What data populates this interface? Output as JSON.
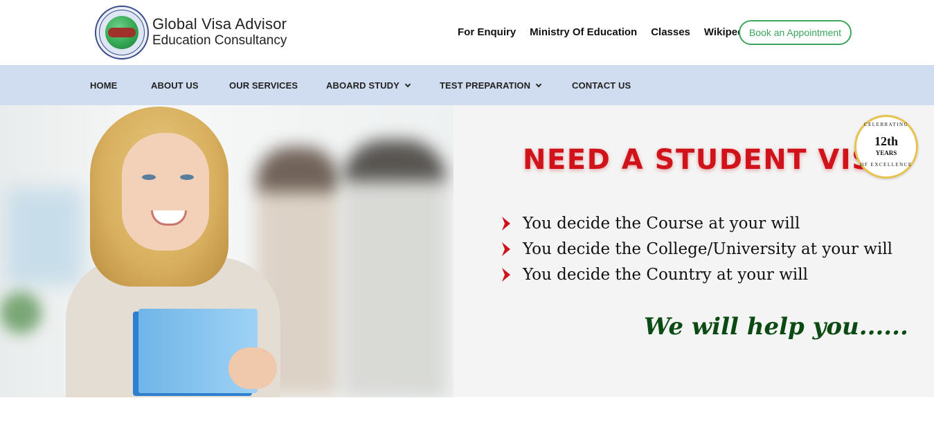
{
  "header": {
    "brand_line1": "Global Visa Advisor",
    "brand_line2": "Education Consultancy",
    "top_links": [
      "For Enquiry",
      "Ministry Of Education",
      "Classes",
      "Wikipedia"
    ],
    "cta_label": "Book an Appointment",
    "cta_color": "#3ba55c"
  },
  "nav": {
    "items": [
      {
        "label": "HOME",
        "has_dropdown": false
      },
      {
        "label": "ABOUT US",
        "has_dropdown": false
      },
      {
        "label": "OUR SERVICES",
        "has_dropdown": false
      },
      {
        "label": "ABOARD STUDY",
        "has_dropdown": true
      },
      {
        "label": "TEST PREPARATION",
        "has_dropdown": true
      },
      {
        "label": "CONTACT US",
        "has_dropdown": false
      }
    ],
    "background": "#d0dcef"
  },
  "hero": {
    "headline": "NEED A STUDENT VISA",
    "headline_color": "#d0121b",
    "badge": {
      "top": "CELEBRATING",
      "number": "12th",
      "unit": "YEARS",
      "bottom": "OF EXCELLENCE"
    },
    "bullets": [
      "You decide the Course at your will",
      "You decide the College/University at your will",
      "You decide the Country at your will"
    ],
    "tagline": "We will help you......",
    "tagline_color": "#0b4a12"
  }
}
